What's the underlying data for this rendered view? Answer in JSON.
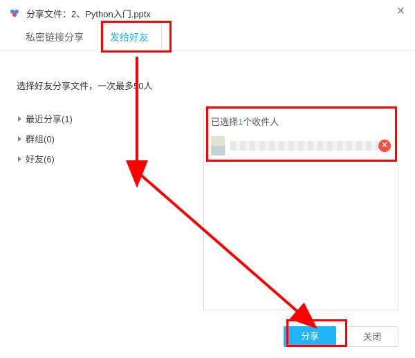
{
  "title": "分享文件：2、Python入门.pptx",
  "tabs": {
    "private": "私密链接分享",
    "friends": "发给好友"
  },
  "instruction": "选择好友分享文件，一次最多50人",
  "tree": {
    "recent": "最近分享(1)",
    "groups": "群组(0)",
    "friends": "好友(6)"
  },
  "right": {
    "selected_prefix": "已选择",
    "selected_count": "1",
    "selected_suffix": "个收件人",
    "recipient_name": ""
  },
  "footer": {
    "share": "分享",
    "close": "关闭"
  }
}
